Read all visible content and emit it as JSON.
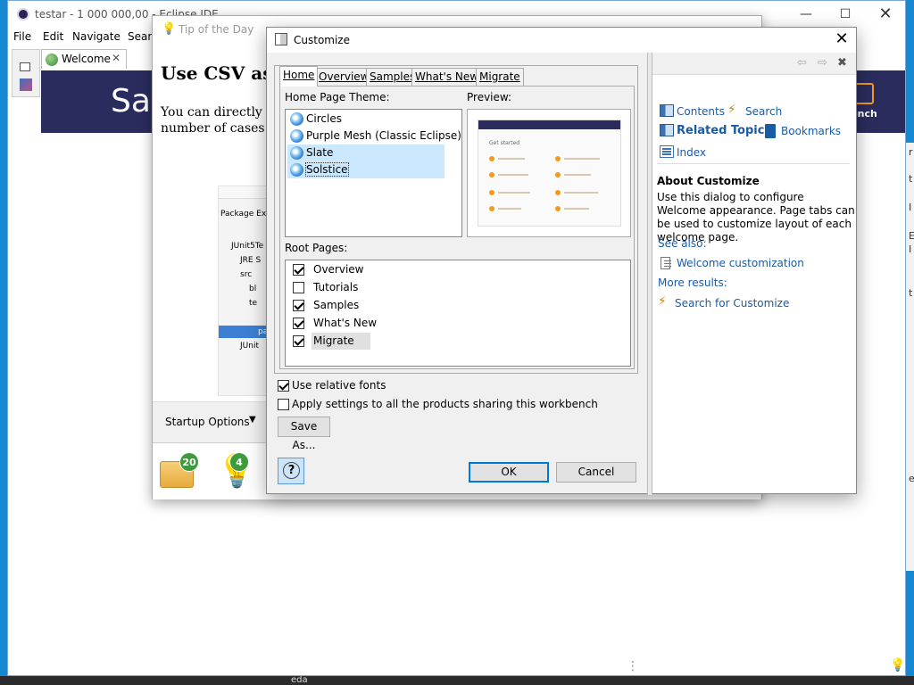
{
  "eclipse": {
    "title": "testar - 1 000 000,00 - Eclipse IDE",
    "menu": [
      "File",
      "Edit",
      "Navigate",
      "Searc"
    ],
    "welcome_tab": "Welcome",
    "banner_text": "Sa",
    "workbench_label": "kbench",
    "taskbar_item": "eda"
  },
  "tip": {
    "title": "Tip of the Day",
    "heading": "Use CSV as",
    "body_line1": "You can directly u",
    "body_line2": "number of cases.",
    "shot_items": [
      "Package Ex",
      "JUnit5Te",
      "JRE S",
      "src",
      "bl",
      "te",
      "pa",
      "JUnit"
    ],
    "startup_options": "Startup Options",
    "badge_left": "20",
    "badge_right": "4"
  },
  "dialog": {
    "title": "Customize",
    "tabs": [
      "Home",
      "Overview",
      "Samples",
      "What's New",
      "Migrate"
    ],
    "active_tab": "Home",
    "theme_label": "Home Page Theme:",
    "preview_label": "Preview:",
    "themes": [
      {
        "label": "Circles",
        "selected": false
      },
      {
        "label": "Purple Mesh (Classic Eclipse)",
        "selected": false
      },
      {
        "label": "Slate",
        "selected": true
      },
      {
        "label": "Solstice",
        "selected": true
      }
    ],
    "preview_caption": "Get started",
    "root_label": "Root Pages:",
    "root_pages": [
      {
        "label": "Overview",
        "checked": true
      },
      {
        "label": "Tutorials",
        "checked": false
      },
      {
        "label": "Samples",
        "checked": true
      },
      {
        "label": "What's New",
        "checked": true
      },
      {
        "label": "Migrate",
        "checked": true
      }
    ],
    "use_relative_fonts": {
      "label": "Use relative fonts",
      "checked": true
    },
    "apply_settings": {
      "label": "Apply settings to all the products sharing this workbench",
      "checked": false
    },
    "save_as": "Save As...",
    "ok": "OK",
    "cancel": "Cancel",
    "help_symbol": "?"
  },
  "help": {
    "contents": "Contents",
    "search": "Search",
    "related_topics": "Related Topics",
    "bookmarks": "Bookmarks",
    "index": "Index",
    "about_title": "About Customize",
    "about_text": "Use this dialog to configure Welcome appearance. Page tabs can be used to customize layout of each welcome page.",
    "see_also": "See also:",
    "welcome_customization": "Welcome customization",
    "more_results": "More results:",
    "search_for": "Search for Customize"
  },
  "side_chars": [
    "r",
    "t",
    "I",
    "E",
    "I",
    "t",
    "e"
  ],
  "colors": {
    "accent": "#0078d7",
    "link": "#1a5ba6",
    "banner": "#2a2c5e",
    "badge": "#3d9b3d"
  }
}
